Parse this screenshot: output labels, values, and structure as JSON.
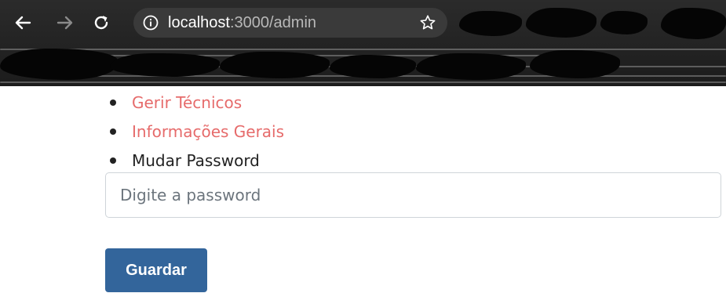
{
  "browser": {
    "url_host": "localhost",
    "url_path": ":3000/admin",
    "icons": {
      "back": "back-arrow-icon",
      "forward": "forward-arrow-icon",
      "reload": "reload-icon",
      "site_info": "info-icon",
      "bookmark": "star-icon"
    }
  },
  "menu": {
    "items": [
      {
        "label": "Gerir Técnicos",
        "link": true
      },
      {
        "label": "Informações Gerais",
        "link": true
      },
      {
        "label": "Mudar Password",
        "link": false
      }
    ]
  },
  "form": {
    "password_placeholder": "Digite a password",
    "save_label": "Guardar"
  },
  "colors": {
    "link": "#e66b6b",
    "button": "#33659b",
    "chrome": "#1c1c1c"
  }
}
